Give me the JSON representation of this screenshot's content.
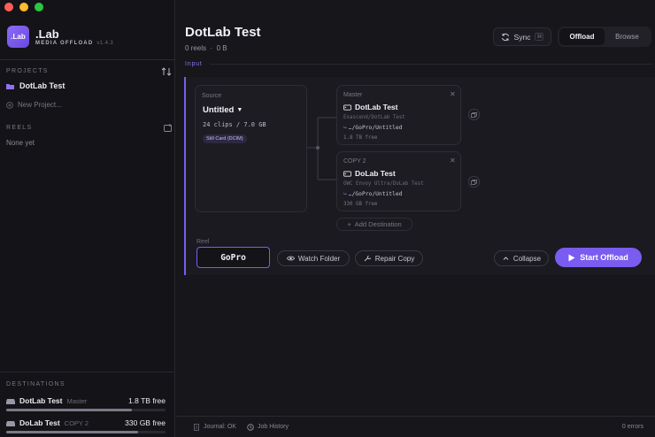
{
  "window": {
    "traffic_lights": [
      "close",
      "minimize",
      "zoom"
    ]
  },
  "app": {
    "logo_text": ".Lab",
    "name": ".Lab",
    "subtitle": "MEDIA OFFLOAD",
    "version": "v1.4.3",
    "accent": "#7a5cf0"
  },
  "sidebar": {
    "projects_label": "PROJECTS",
    "projects": [
      {
        "name": "DotLab Test",
        "icon": "folder-icon"
      }
    ],
    "new_project_label": "New Project...",
    "reels_label": "REELS",
    "reels_empty": "None yet",
    "destinations_label": "DESTINATIONS",
    "destinations": [
      {
        "name": "DotLab Test",
        "role": "Master",
        "free": "1.8 TB free",
        "fill": 0.79
      },
      {
        "name": "DoLab Test",
        "role": "COPY 2",
        "free": "330 GB free",
        "fill": 0.83
      }
    ]
  },
  "header": {
    "title": "DotLab Test",
    "reels_count": "0 reels",
    "size": "0 B",
    "sync_label": "Sync",
    "sync_shortcut": "⌘",
    "modes": [
      "Offload",
      "Browse"
    ],
    "active_mode": "Offload"
  },
  "input": {
    "section_label": "Input",
    "source": {
      "label": "Source",
      "name": "Untitled",
      "meta": "24 clips / 7.0 GB",
      "tag": "Still Card (DCIM)"
    },
    "destinations": [
      {
        "role": "Master",
        "name": "DotLab Test",
        "path": "Exascend/DotLab Test",
        "target": "…/GoPro/Untitled",
        "free": "1.8 TB free"
      },
      {
        "role": "COPY 2",
        "name": "DoLab Test",
        "path": "OWC Envoy Ultra/DoLab Test",
        "target": "…/GoPro/Untitled",
        "free": "330 GB free"
      }
    ],
    "add_destination_label": "Add Destination",
    "reel_label": "Reel",
    "reel_value": "GoPro",
    "watch_folder_label": "Watch Folder",
    "repair_copy_label": "Repair Copy",
    "collapse_label": "Collapse",
    "start_label": "Start Offload"
  },
  "footer": {
    "journal": "Journal: OK",
    "job_history": "Job History",
    "errors": "0 errors"
  }
}
